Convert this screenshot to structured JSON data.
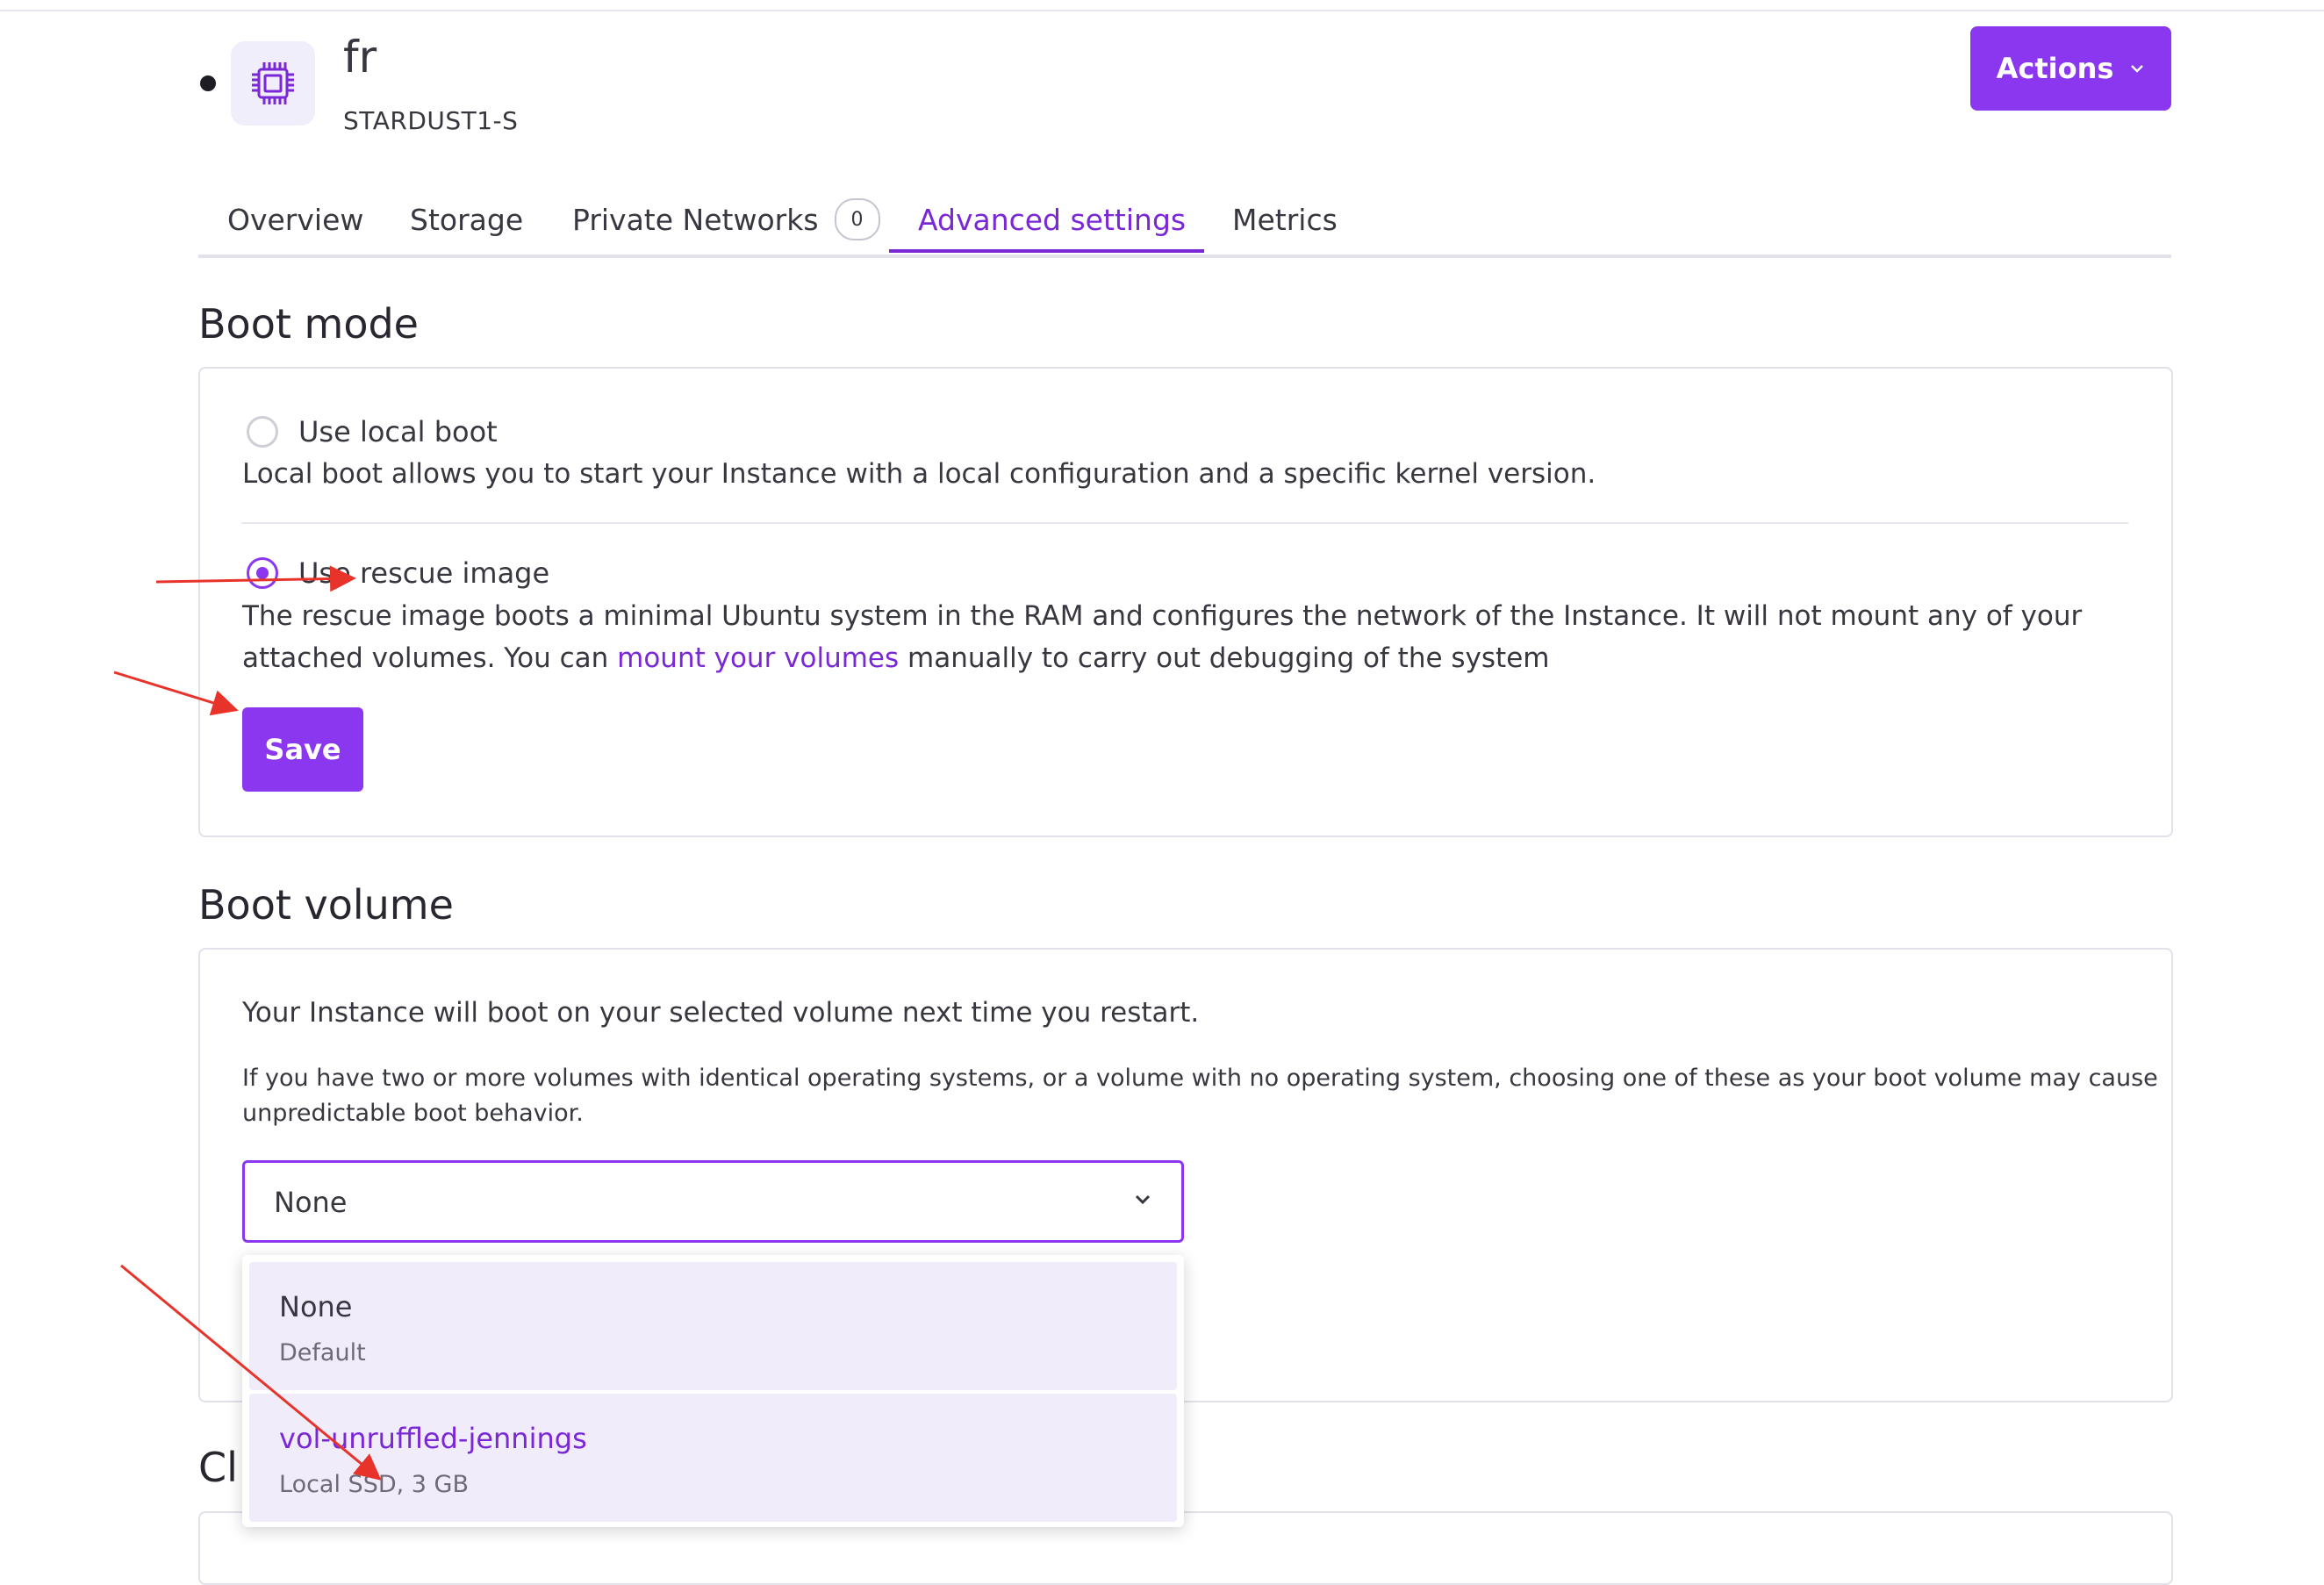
{
  "instance": {
    "name": "fr",
    "type": "STARDUST1-S",
    "avatar_icon": "cpu-chip-icon",
    "status_icon": "status-dot-icon"
  },
  "actions": {
    "label": "Actions",
    "icon": "chevron-down-icon"
  },
  "tabs": [
    {
      "label": "Overview"
    },
    {
      "label": "Storage"
    },
    {
      "label": "Private Networks",
      "badge": "0"
    },
    {
      "label": "Advanced settings",
      "active": true
    },
    {
      "label": "Metrics"
    }
  ],
  "boot_mode": {
    "title": "Boot mode",
    "local": {
      "label": "Use local boot",
      "description": "Local boot allows you to start your Instance with a local configuration and a specific kernel version.",
      "selected": false
    },
    "rescue": {
      "label": "Use rescue image",
      "description_line1": "The rescue image boots a minimal Ubuntu system in the RAM and configures the network of the Instance. It will not mount any of your",
      "description_line2_prefix": "attached volumes. You can ",
      "description_link": "mount your volumes",
      "description_line2_suffix": " manually to carry out debugging of the system",
      "selected": true
    },
    "save_label": "Save"
  },
  "boot_volume": {
    "title": "Boot volume",
    "info": "Your Instance will boot on your selected volume next time you restart.",
    "warning_line1": "If you have two or more volumes with identical operating systems, or a volume with no operating system, choosing one of these as your boot volume may cause",
    "warning_line2": "unpredictable boot behavior.",
    "select_value": "None",
    "options": [
      {
        "title": "None",
        "subtitle": "Default"
      },
      {
        "title": "vol-unruffled-jennings",
        "subtitle": "Local SSD, 3 GB"
      }
    ]
  },
  "next_section_partial": "Cl",
  "colors": {
    "accent": "#8a37ef",
    "accent_text": "#7a27d6",
    "annotation_arrow": "#e8332a"
  }
}
